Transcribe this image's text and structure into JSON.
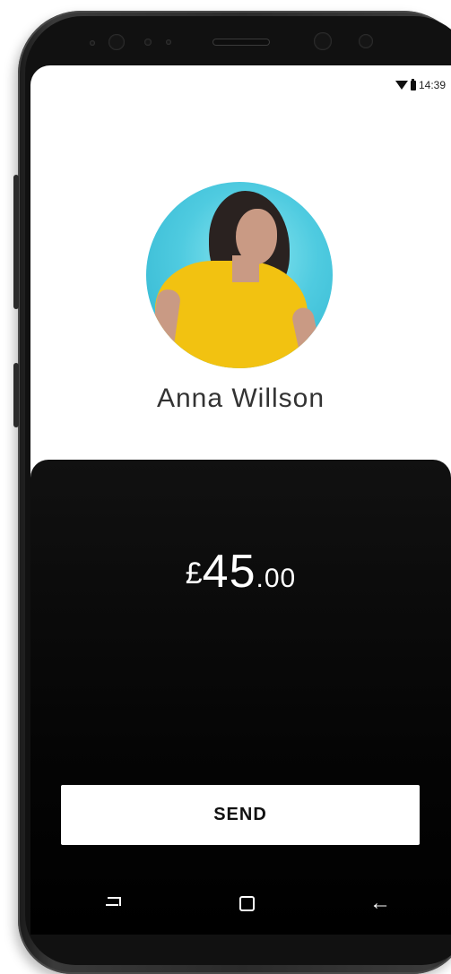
{
  "status_bar": {
    "time": "14:39"
  },
  "contact": {
    "name": "Anna Willson"
  },
  "amount": {
    "currency": "£",
    "whole": "45",
    "decimal": ".00"
  },
  "actions": {
    "send_label": "SEND"
  },
  "nav_icons": [
    "recents-icon",
    "home-icon",
    "back-icon"
  ],
  "colors": {
    "panel": "#000000",
    "avatar_bg": "#4fcbe0",
    "shirt": "#f2c211"
  }
}
